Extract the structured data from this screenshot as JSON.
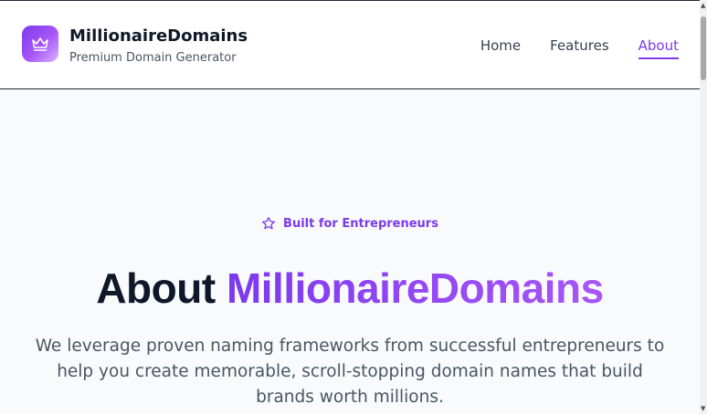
{
  "header": {
    "brand_name": "MillionaireDomains",
    "tagline": "Premium Domain Generator",
    "logo_icon": "crown-icon"
  },
  "nav": {
    "items": [
      {
        "label": "Home",
        "active": false
      },
      {
        "label": "Features",
        "active": false
      },
      {
        "label": "About",
        "active": true
      }
    ]
  },
  "hero": {
    "badge_icon": "star-icon",
    "badge_text": "Built for Entrepreneurs",
    "title_prefix": "About",
    "title_accent": "MillionaireDomains",
    "description": "We leverage proven naming frameworks from successful entrepreneurs to help you create memorable, scroll-stopping domain names that build brands worth millions."
  },
  "colors": {
    "accent": "#7c3aed",
    "accent_light": "#a855f7",
    "heading": "#0f172a",
    "body_text": "#4b5563",
    "page_background": "#f9fafb"
  }
}
